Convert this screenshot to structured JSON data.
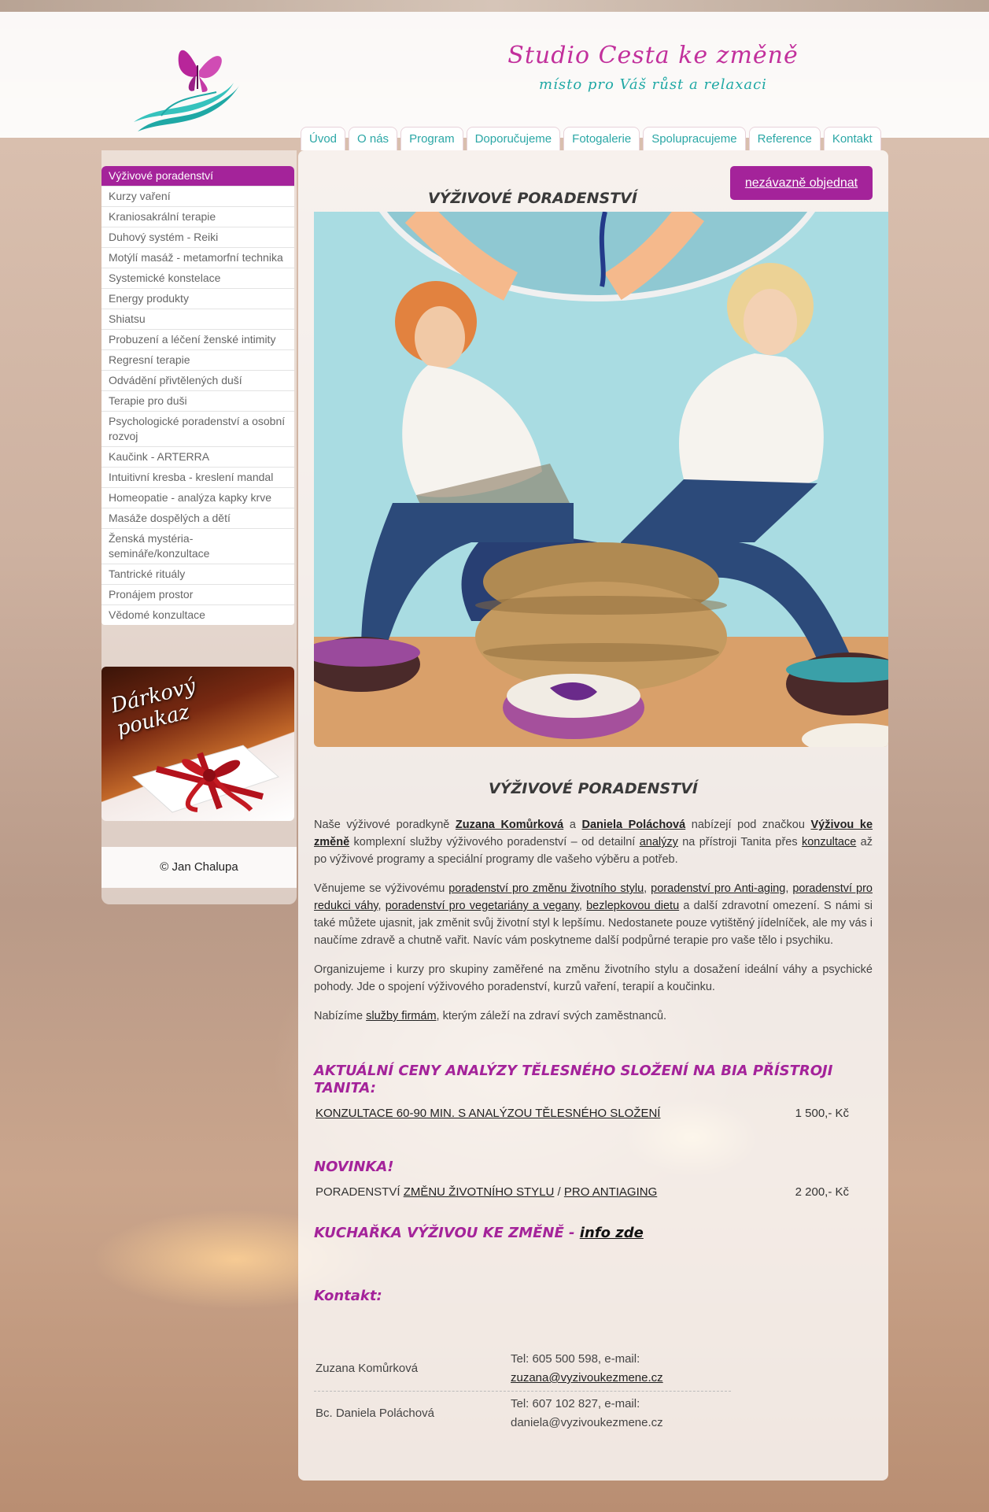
{
  "brand": {
    "title": "Studio Cesta ke změně",
    "subtitle": "místo pro Váš růst a relaxaci"
  },
  "nav": [
    {
      "label": "Úvod"
    },
    {
      "label": "O nás"
    },
    {
      "label": "Program"
    },
    {
      "label": "Doporučujeme"
    },
    {
      "label": "Fotogalerie"
    },
    {
      "label": "Spolupracujeme"
    },
    {
      "label": "Reference"
    },
    {
      "label": "Kontakt"
    }
  ],
  "sidebar": {
    "items": [
      {
        "label": "Výživové poradenství"
      },
      {
        "label": "Kurzy vaření"
      },
      {
        "label": "Kraniosakrální terapie"
      },
      {
        "label": "Duhový systém - Reiki"
      },
      {
        "label": "Motýlí masáž - metamorfní technika"
      },
      {
        "label": "Systemické konstelace"
      },
      {
        "label": "Energy produkty"
      },
      {
        "label": "Shiatsu"
      },
      {
        "label": "Probuzení a léčení ženské intimity"
      },
      {
        "label": "Regresní terapie"
      },
      {
        "label": "Odvádění přivtělených duší"
      },
      {
        "label": "Terapie pro duši"
      },
      {
        "label": "Psychologické poradenství a osobní rozvoj"
      },
      {
        "label": "Kaučink - ARTERRA"
      },
      {
        "label": "Intuitivní kresba - kreslení mandal"
      },
      {
        "label": "Homeopatie - analýza kapky krve"
      },
      {
        "label": "Masáže dospělých a dětí"
      },
      {
        "label": "Ženská mystéria- semináře/konzultace"
      },
      {
        "label": "Tantrické rituály"
      },
      {
        "label": "Pronájem prostor"
      },
      {
        "label": "Vědomé konzultace"
      }
    ],
    "voucher": "Dárkový poukaz",
    "footer": "© Jan Chalupa"
  },
  "main": {
    "cta": "nezávazně objednat",
    "heading": "VÝŽIVOVÉ PORADENSTVÍ",
    "content_heading": "VÝŽIVOVÉ PORADENSTVÍ",
    "p1": {
      "t1": "Naše výživové poradkyně ",
      "name1": "Zuzana Komůrková",
      "t2": " a ",
      "name2": "Daniela Poláchová",
      "t3": " nabízejí pod značkou ",
      "brand": "Výživou ke změně",
      "t4": " komplexní služby výživového poradenství – od detailní ",
      "link1": "analýzy",
      "t5": " na přístroji Tanita přes ",
      "link2": "konzultace",
      "t6": " až po výživové programy a speciální programy dle vašeho výběru a potřeb."
    },
    "p2": {
      "t1": "Věnujeme se výživovému ",
      "l1": "poradenství pro změnu životního stylu",
      "s1": ", ",
      "l2": "poradenství pro Anti-aging",
      "s2": ", ",
      "l3": "poradenství pro redukci váhy",
      "s3": ", ",
      "l4": "poradenství pro vegetariány a vegany",
      "s4": ", ",
      "l5": "bezlepkovou dietu",
      "t2": " a další zdravotní omezení. S námi si také můžete ujasnit, jak změnit svůj životní styl k lepšímu. Nedostanete pouze vytištěný jídelníček, ale my vás i naučíme zdravě a chutně vařit. Navíc vám poskytneme další podpůrné terapie pro vaše tělo i psychiku."
    },
    "p3": "Organizujeme i kurzy pro skupiny zaměřené na změnu životního stylu a dosažení ideální váhy a psychické pohody. Jde o spojení výživového poradenství, kurzů vaření, terapií a koučinku.",
    "p4": {
      "t1": "Nabízíme ",
      "link": "služby firmám",
      "t2": ", kterým záleží na zdraví svých zaměstnanců."
    },
    "prices_title": "AKTUÁLNÍ CENY ANALÝZY TĚLESNÉHO SLOŽENÍ NA BIA PŘÍSTROJI TANITA:",
    "price1": {
      "label": "KONZULTACE 60-90 MIN. S ANALÝZOU TĚLESNÉHO SLOŽENÍ",
      "price": "1 500,- Kč"
    },
    "news_title": "NOVINKA!",
    "price2": {
      "t1": "PORADENSTVÍ ",
      "l1": "ZMĚNU ŽIVOTNÍHO STYLU",
      "sep": " / ",
      "l2": "PRO ANTIAGING",
      "price": "2 200,- Kč"
    },
    "cookbook": {
      "text": "KUCHAŘKA VÝŽIVOU KE ZMĚNĚ - ",
      "link": "info zde"
    },
    "contact_title": "Kontakt:",
    "contacts": [
      {
        "name": "Zuzana Komůrková",
        "tel": "Tel: 605 500 598, e-mail:",
        "email": "zuzana@vyzivoukezmene.cz"
      },
      {
        "name": "Bc. Daniela Poláchová",
        "tel": "Tel: 607 102 827, e-mail:",
        "email": "daniela@vyzivoukezmene.cz"
      }
    ]
  },
  "colors": {
    "accent": "#a4239a",
    "brand_pink": "#c2309c",
    "brand_teal": "#1fa8a5",
    "nav_text": "#2ba7a6"
  },
  "icons": {
    "logo": "butterfly-hand-icon"
  }
}
